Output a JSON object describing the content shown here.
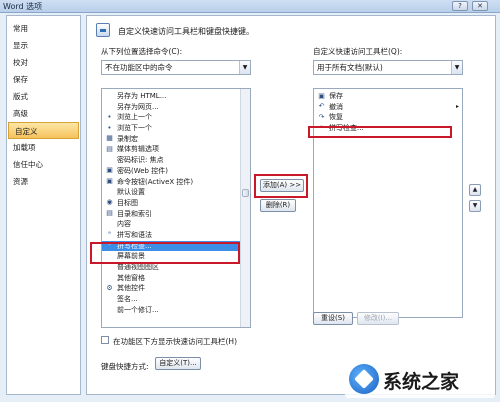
{
  "window": {
    "title": "Word 选项",
    "controls": {
      "help": "?",
      "close": "✕"
    }
  },
  "nav": {
    "items": [
      {
        "label": "常用"
      },
      {
        "label": "显示"
      },
      {
        "label": "校对"
      },
      {
        "label": "保存"
      },
      {
        "label": "版式"
      },
      {
        "label": "高级"
      },
      {
        "label": "自定义",
        "selected": true
      },
      {
        "label": "加载项"
      },
      {
        "label": "信任中心"
      },
      {
        "label": "资源"
      }
    ]
  },
  "main": {
    "header": "自定义快速访问工具栏和键盘快捷键。",
    "left_label": "从下列位置选择命令(C):",
    "left_dropdown": "不在功能区中的命令",
    "right_label": "自定义快速访问工具栏(Q):",
    "right_dropdown": "用于所有文档(默认)",
    "commands": [
      {
        "icon": "",
        "label": "另存为 HTML..."
      },
      {
        "icon": "",
        "label": "另存为网页..."
      },
      {
        "icon": "•",
        "label": "浏览上一个"
      },
      {
        "icon": "•",
        "label": "浏览下一个"
      },
      {
        "icon": "▦",
        "label": "录制宏"
      },
      {
        "icon": "▤",
        "label": "媒体剪辑选项"
      },
      {
        "icon": "",
        "label": "密码标识: 焦点"
      },
      {
        "icon": "▣",
        "label": "密码(Web 控件)"
      },
      {
        "icon": "▣",
        "label": "命令按钮(ActiveX 控件)"
      },
      {
        "icon": "",
        "label": "默认设置"
      },
      {
        "icon": "◉",
        "label": "目标图"
      },
      {
        "icon": "▤",
        "label": "目录和索引"
      },
      {
        "icon": "",
        "label": "内容"
      },
      {
        "icon": "ᵃ",
        "label": "拼写和语法"
      },
      {
        "icon": "ᵃ",
        "label": "拼写检查...",
        "selected": true
      },
      {
        "icon": "",
        "label": "屏幕前景"
      },
      {
        "icon": "",
        "label": "普通视图图区"
      },
      {
        "icon": "",
        "label": "其他窗格"
      },
      {
        "icon": "⚙",
        "label": "其他控件"
      },
      {
        "icon": "",
        "label": "签名..."
      },
      {
        "icon": "",
        "label": "前一个修订..."
      }
    ],
    "toolbar_items": [
      {
        "icon": "▣",
        "label": "保存"
      },
      {
        "icon": "↶",
        "label": "撤消",
        "has_arrow": true
      },
      {
        "icon": "↷",
        "label": "恢复"
      },
      {
        "icon": "ᵃ",
        "label": "拼写检查..."
      }
    ],
    "add_button": "添加(A) >>",
    "remove_button": "删除(R)",
    "reset_button": "重设(S)",
    "modify_button": "修改(I)...",
    "show_below_checkbox": "在功能区下方显示快速访问工具栏(H)",
    "keyboard_label": "键盘快捷方式:",
    "customize_button": "自定义(T)...",
    "up_arrow": "▲",
    "down_arrow": "▼"
  },
  "watermark": {
    "text": "系统之家"
  }
}
